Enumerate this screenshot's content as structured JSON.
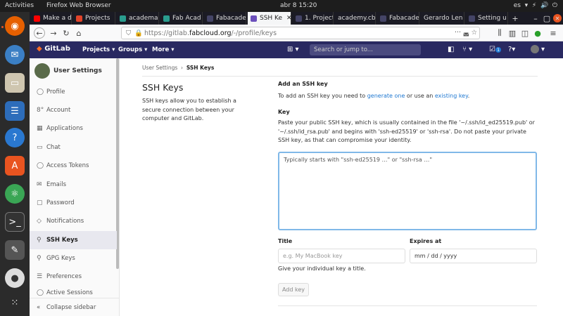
{
  "os": {
    "activities": "Activities",
    "app_name": "Firefox Web Browser",
    "clock": "abr 8  15:20",
    "lang": "es"
  },
  "browser": {
    "tabs": [
      {
        "label": "Make a d",
        "fav_color": "#ff0000"
      },
      {
        "label": "Projects",
        "fav_color": "#e24329"
      },
      {
        "label": "academa",
        "fav_color": "#2a9d8f"
      },
      {
        "label": "Fab Acad",
        "fav_color": "#2a9d8f"
      },
      {
        "label": "Fabacade",
        "fav_color": "#444466"
      },
      {
        "label": "SSH Ke",
        "fav_color": "#6b4fbb"
      },
      {
        "label": "1. Project",
        "fav_color": "#444466"
      },
      {
        "label": "academy.cba",
        "fav_color": "#888888"
      },
      {
        "label": "Fabacade",
        "fav_color": "#444466"
      },
      {
        "label": "Gerardo Len",
        "fav_color": "#888888"
      },
      {
        "label": "Setting u",
        "fav_color": "#444466"
      }
    ],
    "new_tab": "+",
    "url_prefix": "https://gitlab.",
    "url_domain": "fabcloud.org",
    "url_path": "/-/profile/keys"
  },
  "gitlab": {
    "logo": "GitLab",
    "nav": [
      "Projects",
      "Groups",
      "More"
    ],
    "search_placeholder": "Search or jump to...",
    "todo_count": "1"
  },
  "sidebar": {
    "title": "User Settings",
    "items": [
      {
        "label": "Profile",
        "icon": "user-icon",
        "glyph": "◯"
      },
      {
        "label": "Account",
        "icon": "account-icon",
        "glyph": "8°"
      },
      {
        "label": "Applications",
        "icon": "applications-icon",
        "glyph": "▦"
      },
      {
        "label": "Chat",
        "icon": "chat-icon",
        "glyph": "▭"
      },
      {
        "label": "Access Tokens",
        "icon": "token-icon",
        "glyph": "◯"
      },
      {
        "label": "Emails",
        "icon": "mail-icon",
        "glyph": "✉"
      },
      {
        "label": "Password",
        "icon": "lock-icon",
        "glyph": "▢"
      },
      {
        "label": "Notifications",
        "icon": "bell-icon",
        "glyph": "◇"
      },
      {
        "label": "SSH Keys",
        "icon": "key-icon",
        "glyph": "⚲"
      },
      {
        "label": "GPG Keys",
        "icon": "gpg-key-icon",
        "glyph": "⚲"
      },
      {
        "label": "Preferences",
        "icon": "preferences-icon",
        "glyph": "☰"
      },
      {
        "label": "Active Sessions",
        "icon": "sessions-icon",
        "glyph": "◯"
      }
    ],
    "active_index": 8,
    "collapse": "Collapse sidebar"
  },
  "page": {
    "breadcrumb_parent": "User Settings",
    "breadcrumb_sep": "›",
    "breadcrumb_current": "SSH Keys",
    "title": "SSH Keys",
    "description": "SSH keys allow you to establish a secure connection between your computer and GitLab.",
    "add_heading": "Add an SSH key",
    "add_text_before": "To add an SSH key you need to ",
    "add_link1": "generate one",
    "add_text_mid": " or use an ",
    "add_link2": "existing key",
    "add_text_after": ".",
    "key_label": "Key",
    "key_help": "Paste your public SSH key, which is usually contained in the file '~/.ssh/id_ed25519.pub' or '~/.ssh/id_rsa.pub' and begins with 'ssh-ed25519' or 'ssh-rsa'. Do not paste your private SSH key, as that can compromise your identity.",
    "key_placeholder": "Typically starts with \"ssh-ed25519 …\" or \"ssh-rsa …\"",
    "title_label": "Title",
    "title_placeholder": "e.g. My MacBook key",
    "title_help": "Give your individual key a title.",
    "expires_label": "Expires at",
    "expires_value": "mm / dd / yyyy",
    "add_button": "Add key"
  }
}
